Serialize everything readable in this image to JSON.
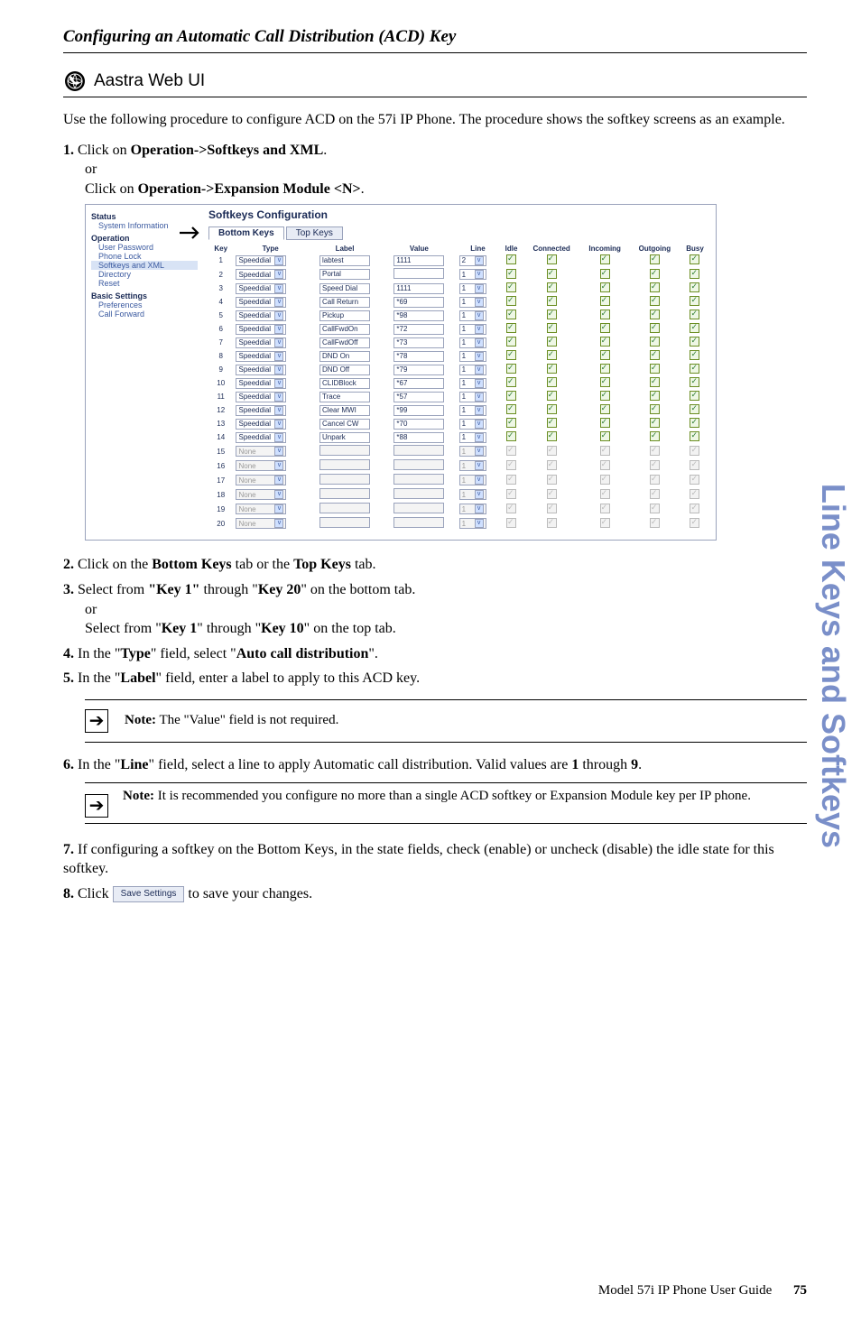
{
  "page_title": "Configuring an Automatic Call Distribution (ACD) Key",
  "section_heading": "Aastra Web UI",
  "intro": "Use the following procedure to configure ACD on the 57i IP Phone. The procedure shows the softkey screens as an example.",
  "step1_prefix": "1.",
  "step1_a": "Click on ",
  "step1_bold_a": "Operation->Softkeys and XML",
  "step1_b": ".",
  "step1_or": "or",
  "step1_c": "Click on ",
  "step1_bold_c": "Operation->Expansion Module <N>",
  "step1_d": ".",
  "nav": {
    "status": "Status",
    "sysinfo": "System Information",
    "operation": "Operation",
    "userpw": "User Password",
    "phonelock": "Phone Lock",
    "softkeys": "Softkeys and XML",
    "directory": "Directory",
    "reset": "Reset",
    "basic": "Basic Settings",
    "prefs": "Preferences",
    "callfwd": "Call Forward"
  },
  "cfg": {
    "title": "Softkeys Configuration",
    "tab_bottom": "Bottom Keys",
    "tab_top": "Top Keys",
    "th": {
      "key": "Key",
      "type": "Type",
      "label": "Label",
      "value": "Value",
      "line": "Line",
      "idle": "Idle",
      "connected": "Connected",
      "incoming": "Incoming",
      "outgoing": "Outgoing",
      "busy": "Busy"
    },
    "rows": [
      {
        "k": "1",
        "type": "Speeddial",
        "label": "labtest",
        "value": "1111",
        "line": "2",
        "en": true
      },
      {
        "k": "2",
        "type": "Speeddial",
        "label": "Portal",
        "value": "",
        "line": "1",
        "en": true
      },
      {
        "k": "3",
        "type": "Speeddial",
        "label": "Speed Dial",
        "value": "1111",
        "line": "1",
        "en": true
      },
      {
        "k": "4",
        "type": "Speeddial",
        "label": "Call Return",
        "value": "*69",
        "line": "1",
        "en": true
      },
      {
        "k": "5",
        "type": "Speeddial",
        "label": "Pickup",
        "value": "*98",
        "line": "1",
        "en": true
      },
      {
        "k": "6",
        "type": "Speeddial",
        "label": "CallFwdOn",
        "value": "*72",
        "line": "1",
        "en": true
      },
      {
        "k": "7",
        "type": "Speeddial",
        "label": "CallFwdOff",
        "value": "*73",
        "line": "1",
        "en": true
      },
      {
        "k": "8",
        "type": "Speeddial",
        "label": "DND On",
        "value": "*78",
        "line": "1",
        "en": true
      },
      {
        "k": "9",
        "type": "Speeddial",
        "label": "DND Off",
        "value": "*79",
        "line": "1",
        "en": true
      },
      {
        "k": "10",
        "type": "Speeddial",
        "label": "CLIDBlock",
        "value": "*67",
        "line": "1",
        "en": true
      },
      {
        "k": "11",
        "type": "Speeddial",
        "label": "Trace",
        "value": "*57",
        "line": "1",
        "en": true
      },
      {
        "k": "12",
        "type": "Speeddial",
        "label": "Clear MWI",
        "value": "*99",
        "line": "1",
        "en": true
      },
      {
        "k": "13",
        "type": "Speeddial",
        "label": "Cancel CW",
        "value": "*70",
        "line": "1",
        "en": true
      },
      {
        "k": "14",
        "type": "Speeddial",
        "label": "Unpark",
        "value": "*88",
        "line": "1",
        "en": true
      },
      {
        "k": "15",
        "type": "None",
        "label": "",
        "value": "",
        "line": "1",
        "en": false
      },
      {
        "k": "16",
        "type": "None",
        "label": "",
        "value": "",
        "line": "1",
        "en": false
      },
      {
        "k": "17",
        "type": "None",
        "label": "",
        "value": "",
        "line": "1",
        "en": false
      },
      {
        "k": "18",
        "type": "None",
        "label": "",
        "value": "",
        "line": "1",
        "en": false
      },
      {
        "k": "19",
        "type": "None",
        "label": "",
        "value": "",
        "line": "1",
        "en": false
      },
      {
        "k": "20",
        "type": "None",
        "label": "",
        "value": "",
        "line": "1",
        "en": false
      }
    ]
  },
  "step2_prefix": "2.",
  "step2_a": "Click on the ",
  "step2_b1": "Bottom Keys",
  "step2_m": " tab or the ",
  "step2_b2": "Top Keys",
  "step2_e": " tab.",
  "step3_prefix": "3.",
  "step3_a": "Select from ",
  "step3_b1": "\"Key 1\"",
  "step3_m": " through \"",
  "step3_b2": "Key 20",
  "step3_e": "\" on the bottom tab.",
  "step3_or": "or",
  "step3_a2": "Select from \"",
  "step3_b3": "Key 1",
  "step3_m2": "\" through \"",
  "step3_b4": "Key 10",
  "step3_e2": "\" on the top tab.",
  "step4_prefix": "4.",
  "step4_a": "In the \"",
  "step4_b1": "Type",
  "step4_m": "\" field, select \"",
  "step4_b2": "Auto call distribution",
  "step4_e": "\".",
  "step5_prefix": "5.",
  "step5_a": "In the \"",
  "step5_b1": "Label",
  "step5_e": "\" field, enter a label to apply to this ACD key.",
  "note1_label": "Note:",
  "note1_text": " The \"Value\" field is not required.",
  "step6_prefix": "6.",
  "step6_a": "In the \"",
  "step6_b1": "Line",
  "step6_m": "\" field, select a line to apply Automatic call distribution. Valid values are ",
  "step6_b2": "1",
  "step6_m2": " through ",
  "step6_b3": "9",
  "step6_e": ".",
  "note2_label": "Note:",
  "note2_text": " It is recommended you configure no more than a single ACD softkey or Expansion Module key per IP phone.",
  "step7_prefix": "7.",
  "step7_text": "If configuring a softkey on the Bottom Keys, in the state fields, check (enable) or uncheck (disable) the idle state for this softkey.",
  "step8_prefix": "8.",
  "step8_a": "Click ",
  "step8_btn": "Save Settings",
  "step8_b": " to save your changes.",
  "footer_text": "Model 57i IP Phone User Guide",
  "footer_page": "75",
  "side_text": "Line Keys and Softkeys"
}
